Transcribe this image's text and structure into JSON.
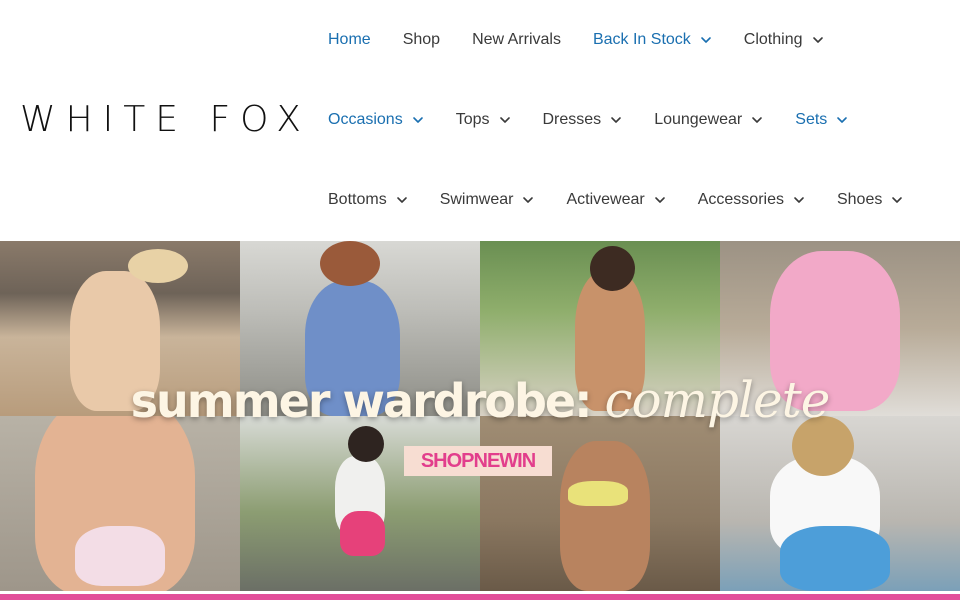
{
  "brand": {
    "logo_text": "WHITE FOX"
  },
  "nav": {
    "row1": [
      {
        "label": "Home",
        "active": true,
        "dropdown": false
      },
      {
        "label": "Shop",
        "active": false,
        "dropdown": false
      },
      {
        "label": "New Arrivals",
        "active": false,
        "dropdown": false
      },
      {
        "label": "Back In Stock",
        "active": true,
        "dropdown": true
      },
      {
        "label": "Clothing",
        "active": false,
        "dropdown": true
      }
    ],
    "row2": [
      {
        "label": "Occasions",
        "active": true,
        "dropdown": true
      },
      {
        "label": "Tops",
        "active": false,
        "dropdown": true
      },
      {
        "label": "Dresses",
        "active": false,
        "dropdown": true
      },
      {
        "label": "Loungewear",
        "active": false,
        "dropdown": true
      },
      {
        "label": "Sets",
        "active": true,
        "dropdown": true
      }
    ],
    "row3": [
      {
        "label": "Bottoms",
        "active": false,
        "dropdown": true
      },
      {
        "label": "Swimwear",
        "active": false,
        "dropdown": true
      },
      {
        "label": "Activewear",
        "active": false,
        "dropdown": true
      },
      {
        "label": "Accessories",
        "active": false,
        "dropdown": true
      },
      {
        "label": "Shoes",
        "active": false,
        "dropdown": true
      }
    ]
  },
  "hero": {
    "title_main": "summer wardrobe:",
    "title_script": "complete",
    "cta_label": "SHOPNEWIN"
  },
  "colors": {
    "nav_active": "#1a6fb0",
    "nav_default": "#3a3a3a",
    "cta_text": "#e23e8c",
    "cta_bg": "#f7ddd2",
    "bottom_strip": "#e24f9a"
  },
  "icons": {
    "dropdown": "chevron-down-icon"
  }
}
